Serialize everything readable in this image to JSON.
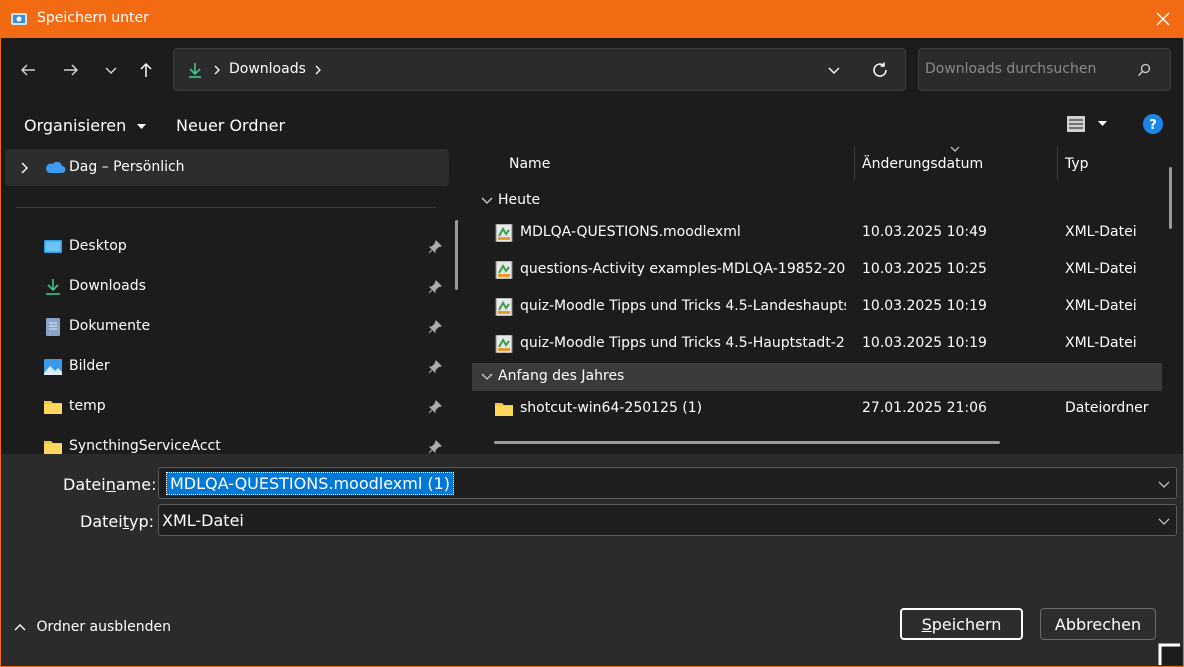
{
  "window": {
    "title": "Speichern unter",
    "accent_color": "#f26a12"
  },
  "nav": {
    "breadcrumb": "Downloads",
    "search_placeholder": "Downloads durchsuchen"
  },
  "toolbar": {
    "organize_label": "Organisieren",
    "new_folder_label": "Neuer Ordner"
  },
  "sidebar": {
    "top_item": "Dag – Persönlich",
    "items": [
      {
        "label": "Desktop",
        "icon": "desktop-icon"
      },
      {
        "label": "Downloads",
        "icon": "downloads-icon"
      },
      {
        "label": "Dokumente",
        "icon": "documents-icon"
      },
      {
        "label": "Bilder",
        "icon": "pictures-icon"
      },
      {
        "label": "temp",
        "icon": "folder-icon"
      },
      {
        "label": "SyncthingServiceAcct",
        "icon": "folder-icon"
      }
    ]
  },
  "columns": {
    "name": "Name",
    "date": "Änderungsdatum",
    "type": "Typ"
  },
  "groups": [
    {
      "label": "Heute",
      "files": [
        {
          "name": "MDLQA-QUESTIONS.moodlexml",
          "date": "10.03.2025 10:49",
          "type": "XML-Datei"
        },
        {
          "name": "questions-Activity examples-MDLQA-19852-20...",
          "date": "10.03.2025 10:25",
          "type": "XML-Datei"
        },
        {
          "name": "quiz-Moodle Tipps und Tricks 4.5-Landeshaupts...",
          "date": "10.03.2025 10:19",
          "type": "XML-Datei"
        },
        {
          "name": "quiz-Moodle Tipps und Tricks 4.5-Hauptstadt-2...",
          "date": "10.03.2025 10:19",
          "type": "XML-Datei"
        }
      ]
    },
    {
      "label": "Anfang des Jahres",
      "files": [
        {
          "name": "shotcut-win64-250125 (1)",
          "date": "27.01.2025 21:06",
          "type": "Dateiordner"
        }
      ]
    }
  ],
  "form": {
    "filename_label_pre": "Datei",
    "filename_label_u": "n",
    "filename_label_post": "ame:",
    "filename_value": "MDLQA-QUESTIONS.moodlexml (1)",
    "filetype_label_pre": "Datei",
    "filetype_label_u": "t",
    "filetype_label_post": "yp:",
    "filetype_value": "XML-Datei"
  },
  "footer": {
    "hide_folders_label": "Ordner ausblenden",
    "save_label_u": "S",
    "save_label_rest": "peichern",
    "cancel_label": "Abbrechen"
  }
}
